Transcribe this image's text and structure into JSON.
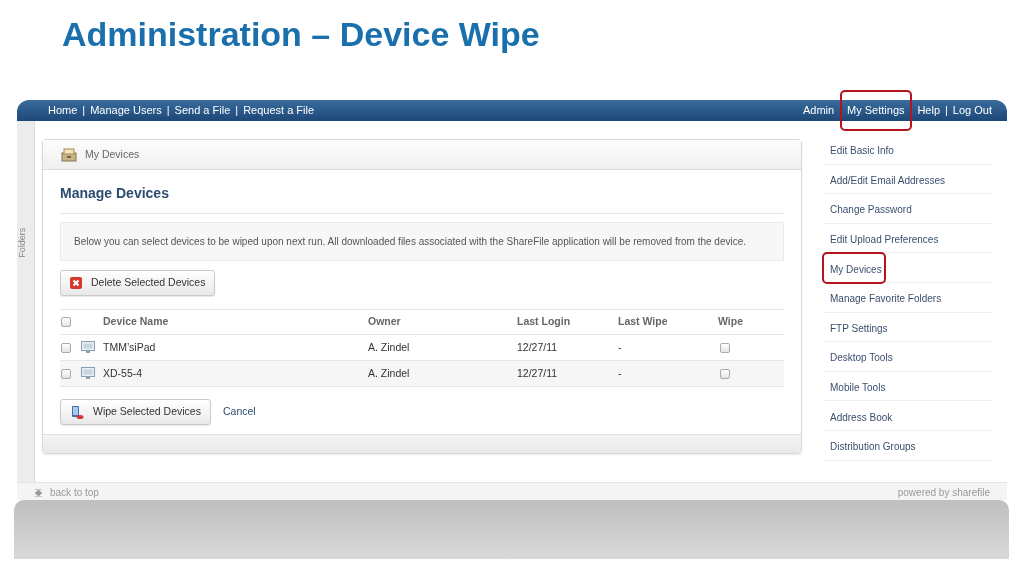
{
  "slide_title": "Administration – Device Wipe",
  "nav": {
    "separator": "|",
    "left": [
      {
        "label": "Home",
        "highlighted": false
      },
      {
        "label": "Manage Users",
        "highlighted": false
      },
      {
        "label": "Send a File",
        "highlighted": false
      },
      {
        "label": "Request a File",
        "highlighted": false
      }
    ],
    "right": [
      {
        "label": "Admin",
        "highlighted": false
      },
      {
        "label": "My Settings",
        "highlighted": true
      },
      {
        "label": "Help",
        "highlighted": false
      },
      {
        "label": "Log Out",
        "highlighted": false
      }
    ]
  },
  "folders_tab": "Folders",
  "panel": {
    "header": "My Devices",
    "heading": "Manage Devices",
    "info": "Below you can select devices to be wiped upon next run. All downloaded files associated with the ShareFile application will be removed from the device.",
    "delete_button": "Delete Selected Devices",
    "columns": [
      "Device Name",
      "Owner",
      "Last Login",
      "Last Wipe",
      "Wipe"
    ],
    "select_all_checked": false,
    "rows": [
      {
        "checked": false,
        "name": "TMM’siPad",
        "owner": "A. Zindel",
        "last_login": "12/27/11",
        "last_wipe": "-",
        "wipe_checked": false
      },
      {
        "checked": false,
        "name": "XD-55-4",
        "owner": "A. Zindel",
        "last_login": "12/27/11",
        "last_wipe": "-",
        "wipe_checked": false
      }
    ],
    "wipe_button": "Wipe Selected Devices",
    "cancel_link": "Cancel"
  },
  "sidebar": {
    "items": [
      {
        "label": "Edit Basic Info",
        "highlighted": false
      },
      {
        "label": "Add/Edit Email Addresses",
        "highlighted": false
      },
      {
        "label": "Change Password",
        "highlighted": false
      },
      {
        "label": "Edit Upload Preferences",
        "highlighted": false
      },
      {
        "label": "My Devices",
        "highlighted": true
      },
      {
        "label": "Manage Favorite Folders",
        "highlighted": false
      },
      {
        "label": "FTP Settings",
        "highlighted": false
      },
      {
        "label": "Desktop Tools",
        "highlighted": false
      },
      {
        "label": "Mobile Tools",
        "highlighted": false
      },
      {
        "label": "Address Book",
        "highlighted": false
      },
      {
        "label": "Distribution Groups",
        "highlighted": false
      }
    ]
  },
  "footer": {
    "back_to_top": "back to top",
    "powered_by": "powered by sharefile"
  }
}
